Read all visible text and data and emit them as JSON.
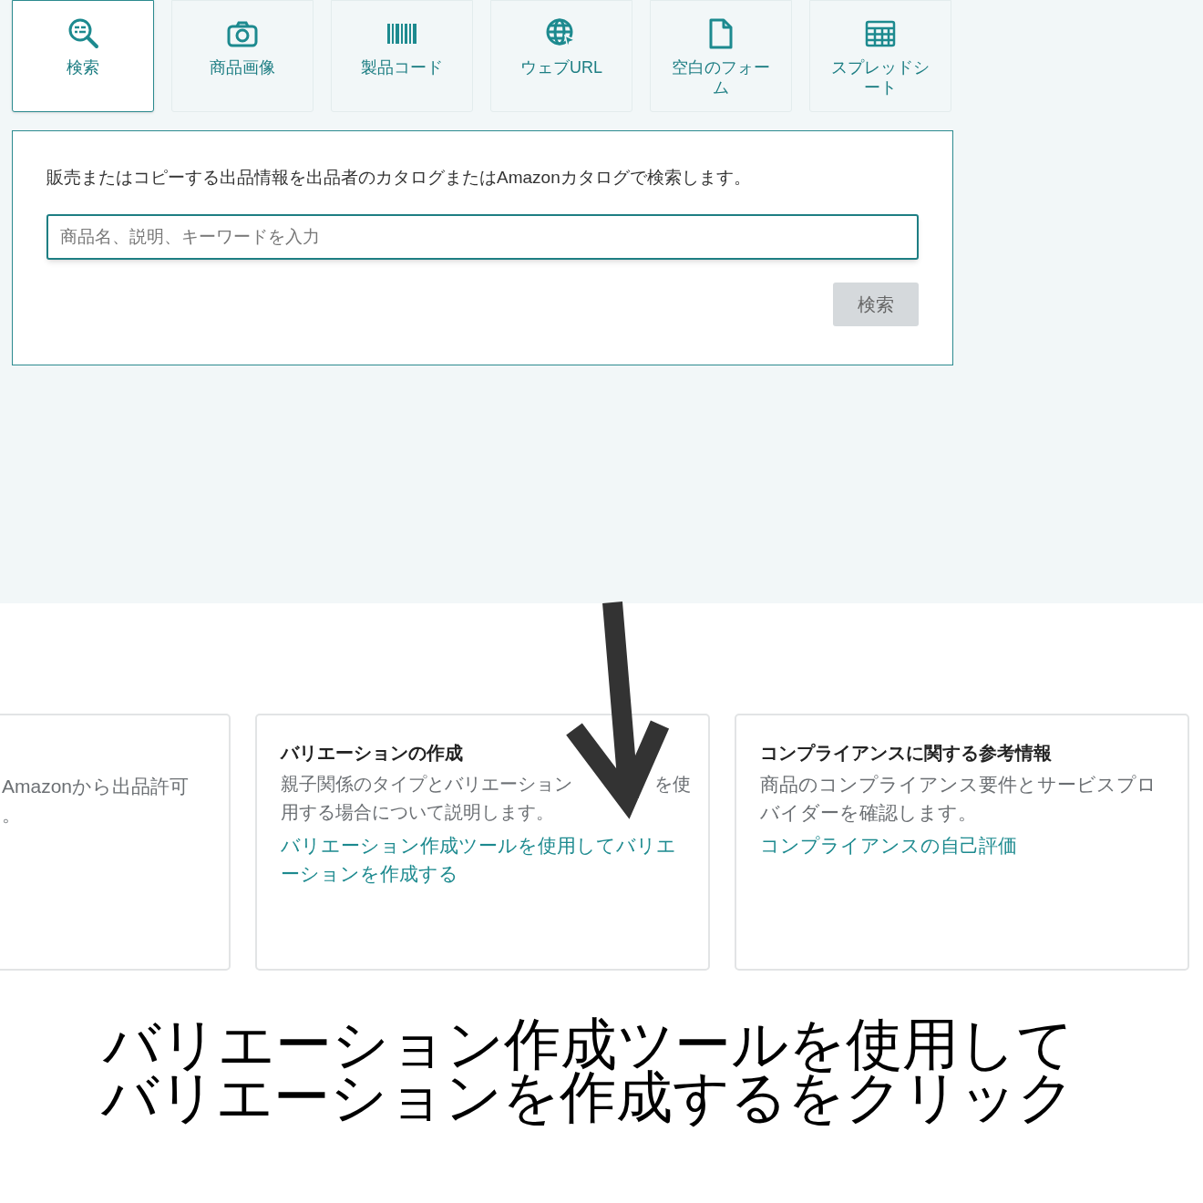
{
  "tabs": [
    {
      "label": "検索",
      "kind": "search",
      "selected": true
    },
    {
      "label": "商品画像",
      "kind": "camera",
      "selected": false
    },
    {
      "label": "製品コード",
      "kind": "barcode",
      "selected": false
    },
    {
      "label": "ウェブURL",
      "kind": "globe",
      "selected": false
    },
    {
      "label": "空白のフォーム",
      "kind": "document",
      "selected": false
    },
    {
      "label": "スプレッドシート",
      "kind": "grid",
      "selected": false
    }
  ],
  "search_panel": {
    "description": "販売またはコピーする出品情報を出品者のカタログまたはAmazonカタログで検索します。",
    "search_field": {
      "placeholder": "商品名、説明、キーワードを入力"
    },
    "search_button": {
      "label": "検索",
      "disabled": true
    }
  },
  "cards": [
    {
      "description_lines": [
        "Amazonから出品許可",
        "。"
      ]
    },
    {
      "title": "バリエーションの作成",
      "description_segments": [
        [
          "親子関係のタイプとバリエーション",
          "を使"
        ],
        [
          "用する場合について説明します。"
        ]
      ],
      "link": "バリエーション作成ツールを使用してバリエーションを作成する"
    },
    {
      "title": "コンプライアンスに関する参考情報",
      "description": "商品のコンプライアンス要件とサービスプロバイダーを確認します。",
      "link": "コンプライアンスの自己評価"
    }
  ],
  "caption": [
    "バリエーション作成ツールを使用して",
    "バリエーションを作成するをクリック"
  ]
}
